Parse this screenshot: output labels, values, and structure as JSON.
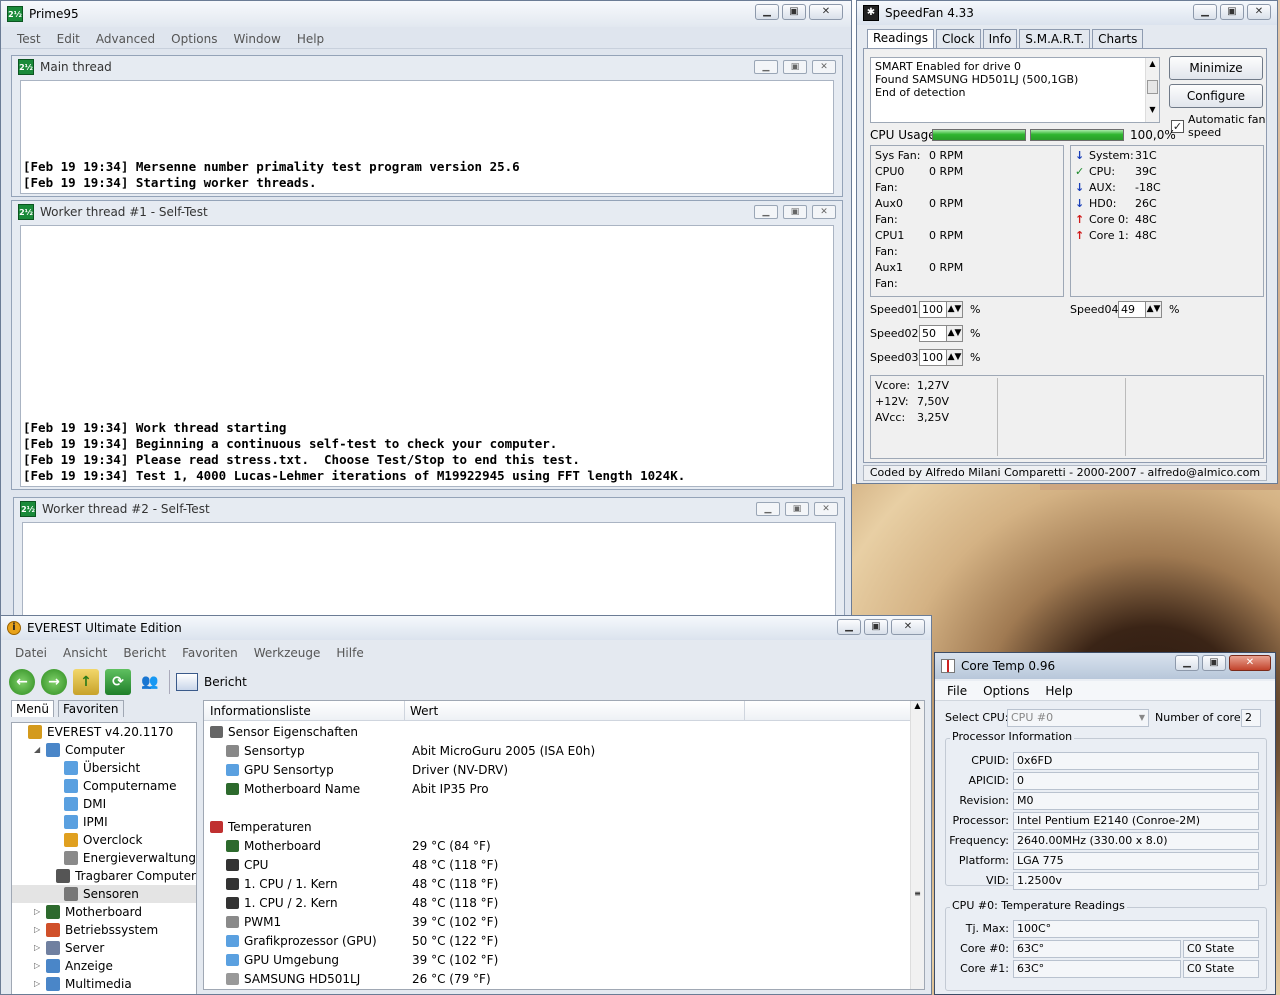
{
  "prime95": {
    "title": "Prime95",
    "menu": [
      "Test",
      "Edit",
      "Advanced",
      "Options",
      "Window",
      "Help"
    ],
    "threads": [
      {
        "title": "Main thread",
        "lines": [
          "[Feb 19 19:34] Mersenne number primality test program version 25.6",
          "[Feb 19 19:34] Starting worker threads."
        ]
      },
      {
        "title": "Worker thread #1 - Self-Test",
        "lines": [
          "[Feb 19 19:34] Work thread starting",
          "[Feb 19 19:34] Beginning a continuous self-test to check your computer.",
          "[Feb 19 19:34] Please read stress.txt.  Choose Test/Stop to end this test.",
          "[Feb 19 19:34] Test 1, 4000 Lucas-Lehmer iterations of M19922945 using FFT length 1024K."
        ]
      },
      {
        "title": "Worker thread #2 - Self-Test",
        "lines": []
      }
    ]
  },
  "speedfan": {
    "title": "SpeedFan 4.33",
    "tabs": [
      "Readings",
      "Clock",
      "Info",
      "S.M.A.R.T.",
      "Charts"
    ],
    "log": [
      "SMART Enabled for drive 0",
      "Found SAMSUNG HD501LJ (500,1GB)",
      "End of detection"
    ],
    "minimize": "Minimize",
    "configure": "Configure",
    "auto_fan": "Automatic fan speed",
    "cpu_usage_label": "CPU Usage",
    "cpu_usage_value": "100,0%",
    "cpu_usage": [
      1.0,
      1.0
    ],
    "fans": [
      {
        "l": "Sys Fan:",
        "v": "0 RPM"
      },
      {
        "l": "CPU0 Fan:",
        "v": "0 RPM"
      },
      {
        "l": "Aux0 Fan:",
        "v": "0 RPM"
      },
      {
        "l": "CPU1 Fan:",
        "v": "0 RPM"
      },
      {
        "l": "Aux1 Fan:",
        "v": "0 RPM"
      }
    ],
    "temps": [
      {
        "l": "System:",
        "v": "31C",
        "s": "down"
      },
      {
        "l": "CPU:",
        "v": "39C",
        "s": "ok"
      },
      {
        "l": "AUX:",
        "v": "-18C",
        "s": "down"
      },
      {
        "l": "HD0:",
        "v": "26C",
        "s": "down"
      },
      {
        "l": "Core 0:",
        "v": "48C",
        "s": "up"
      },
      {
        "l": "Core 1:",
        "v": "48C",
        "s": "up"
      }
    ],
    "speeds": [
      {
        "l": "Speed01:",
        "v": "100"
      },
      {
        "l": "Speed02:",
        "v": "50"
      },
      {
        "l": "Speed03:",
        "v": "100"
      },
      {
        "l": "Speed04:",
        "v": "49"
      }
    ],
    "percent": "%",
    "volts": [
      {
        "l": "Vcore:",
        "v": "1,27V"
      },
      {
        "l": "+12V:",
        "v": "7,50V"
      },
      {
        "l": "AVcc:",
        "v": "3,25V"
      }
    ],
    "footer": "Coded by Alfredo Milani Comparetti - 2000-2007 - alfredo@almico.com"
  },
  "everest": {
    "title": "EVEREST Ultimate Edition",
    "menu": [
      "Datei",
      "Ansicht",
      "Bericht",
      "Favoriten",
      "Werkzeuge",
      "Hilfe"
    ],
    "report": "Bericht",
    "tabs": [
      "Menü",
      "Favoriten"
    ],
    "tree": [
      {
        "t": "EVEREST v4.20.1170",
        "lvl": 0,
        "c": "#d49a1c"
      },
      {
        "t": "Computer",
        "lvl": 1,
        "c": "#4a86c8",
        "exp": "open"
      },
      {
        "t": "Übersicht",
        "lvl": 2,
        "c": "#5aa0e0"
      },
      {
        "t": "Computername",
        "lvl": 2,
        "c": "#5aa0e0"
      },
      {
        "t": "DMI",
        "lvl": 2,
        "c": "#5aa0e0"
      },
      {
        "t": "IPMI",
        "lvl": 2,
        "c": "#5aa0e0"
      },
      {
        "t": "Overclock",
        "lvl": 2,
        "c": "#e0a020"
      },
      {
        "t": "Energieverwaltung",
        "lvl": 2,
        "c": "#8a8a8a"
      },
      {
        "t": "Tragbarer Computer",
        "lvl": 2,
        "c": "#555"
      },
      {
        "t": "Sensoren",
        "lvl": 2,
        "c": "#777",
        "sel": true
      },
      {
        "t": "Motherboard",
        "lvl": 1,
        "c": "#2d6a2d",
        "exp": "closed"
      },
      {
        "t": "Betriebssystem",
        "lvl": 1,
        "c": "#d0502a",
        "exp": "closed"
      },
      {
        "t": "Server",
        "lvl": 1,
        "c": "#7080a0",
        "exp": "closed"
      },
      {
        "t": "Anzeige",
        "lvl": 1,
        "c": "#4a86c8",
        "exp": "closed"
      },
      {
        "t": "Multimedia",
        "lvl": 1,
        "c": "#4a86c8",
        "exp": "closed"
      }
    ],
    "col1": "Informationsliste",
    "col2": "Wert",
    "rows": [
      {
        "k": "Sensor Eigenschaften",
        "v": "",
        "sec": true,
        "c": "#666"
      },
      {
        "k": "Sensortyp",
        "v": "Abit MicroGuru 2005  (ISA E0h)",
        "c": "#888"
      },
      {
        "k": "GPU Sensortyp",
        "v": "Driver  (NV-DRV)",
        "c": "#5aa0e0"
      },
      {
        "k": "Motherboard Name",
        "v": "Abit IP35 Pro",
        "c": "#2d6a2d"
      },
      {
        "k": "",
        "v": "",
        "blank": true
      },
      {
        "k": "Temperaturen",
        "v": "",
        "sec": true,
        "c": "#c03030"
      },
      {
        "k": "Motherboard",
        "v": "29 °C  (84 °F)",
        "c": "#2d6a2d"
      },
      {
        "k": "CPU",
        "v": "48 °C  (118 °F)",
        "c": "#333"
      },
      {
        "k": "1. CPU / 1. Kern",
        "v": "48 °C  (118 °F)",
        "c": "#333"
      },
      {
        "k": "1. CPU / 2. Kern",
        "v": "48 °C  (118 °F)",
        "c": "#333"
      },
      {
        "k": "PWM1",
        "v": "39 °C  (102 °F)",
        "c": "#8a8a8a"
      },
      {
        "k": "Grafikprozessor (GPU)",
        "v": "50 °C  (122 °F)",
        "c": "#5aa0e0"
      },
      {
        "k": "GPU Umgebung",
        "v": "39 °C  (102 °F)",
        "c": "#5aa0e0"
      },
      {
        "k": "SAMSUNG HD501LJ",
        "v": "26 °C  (79 °F)",
        "c": "#999"
      }
    ]
  },
  "coretemp": {
    "title": "Core Temp 0.96",
    "menu": [
      "File",
      "Options",
      "Help"
    ],
    "select_cpu_label": "Select CPU:",
    "select_cpu": "CPU #0",
    "cores_label": "Number of cores",
    "cores": "2",
    "proc_group": "Processor Information",
    "info": [
      {
        "l": "CPUID:",
        "v": "0x6FD"
      },
      {
        "l": "APICID:",
        "v": "0"
      },
      {
        "l": "Revision:",
        "v": "M0"
      },
      {
        "l": "Processor:",
        "v": "Intel Pentium E2140 (Conroe-2M)"
      },
      {
        "l": "Frequency:",
        "v": "2640.00MHz (330.00 x 8.0)"
      },
      {
        "l": "Platform:",
        "v": "LGA 775"
      },
      {
        "l": "VID:",
        "v": "1.2500v"
      }
    ],
    "temp_group": "CPU #0: Temperature Readings",
    "tjmax_label": "Tj. Max:",
    "tjmax": "100C°",
    "cores_t": [
      {
        "l": "Core #0:",
        "v": "63C°",
        "s": "C0 State"
      },
      {
        "l": "Core #1:",
        "v": "63C°",
        "s": "C0 State"
      }
    ]
  }
}
